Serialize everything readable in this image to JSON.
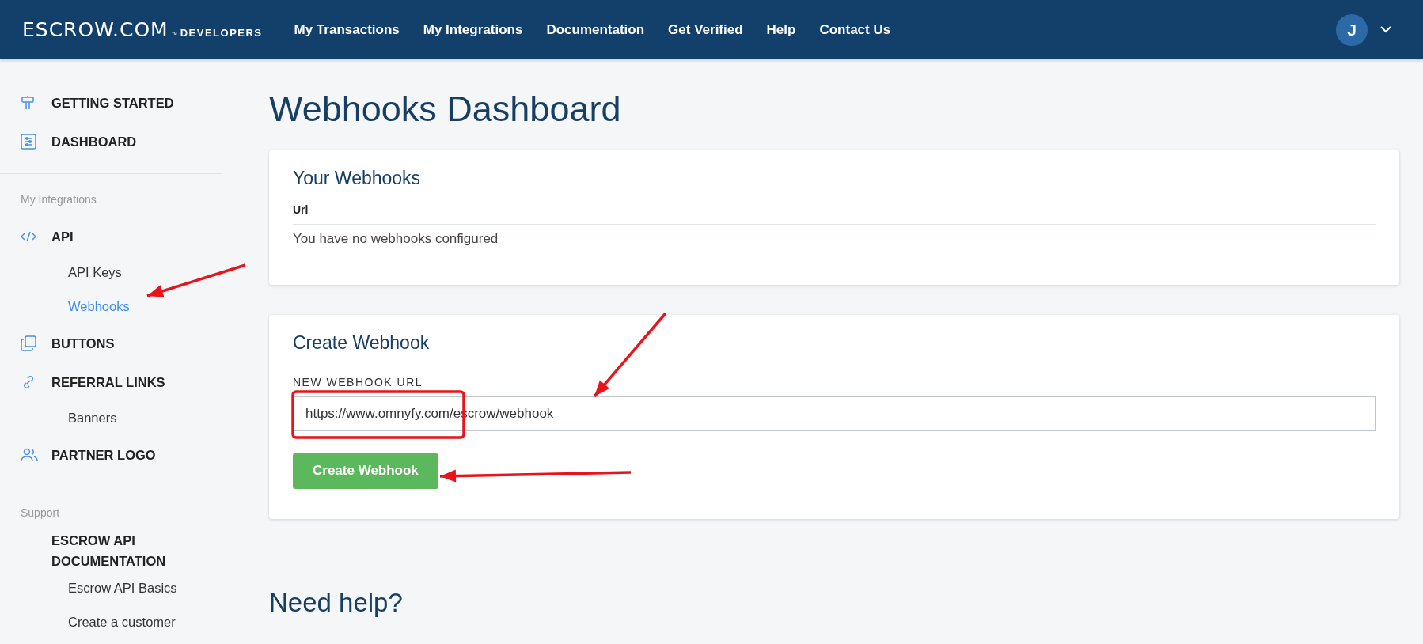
{
  "header": {
    "logo": "ESCROW.COM",
    "logo_mark": "™",
    "logo_sub": "DEVELOPERS",
    "nav": [
      "My Transactions",
      "My Integrations",
      "Documentation",
      "Get Verified",
      "Help",
      "Contact Us"
    ],
    "avatar": "J"
  },
  "sidebar": {
    "sections": [
      {
        "items": [
          {
            "label": "GETTING STARTED",
            "selected": false
          },
          {
            "label": "DASHBOARD",
            "selected": false
          }
        ]
      },
      {
        "heading": "My Integrations",
        "items": [
          {
            "label": "API",
            "selected": false,
            "children": [
              {
                "label": "API Keys",
                "selected": false
              },
              {
                "label": "Webhooks",
                "selected": true
              }
            ]
          },
          {
            "label": "BUTTONS",
            "selected": false
          },
          {
            "label": "REFERRAL LINKS",
            "selected": false,
            "children": [
              {
                "label": "Banners",
                "selected": false
              }
            ]
          },
          {
            "label": "PARTNER LOGO",
            "selected": false
          }
        ]
      },
      {
        "heading": "Support",
        "items": [
          {
            "label": "ESCROW API DOCUMENTATION",
            "selected": false,
            "children": [
              {
                "label": "Escrow API Basics",
                "selected": false
              },
              {
                "label": "Create a customer",
                "selected": false
              }
            ]
          }
        ]
      }
    ]
  },
  "page_title": "Webhooks Dashboard",
  "webhooks_card": {
    "title": "Your Webhooks",
    "column": "Url",
    "empty_message": "You have no webhooks configured"
  },
  "create_card": {
    "title": "Create Webhook",
    "field_label": "NEW WEBHOOK URL",
    "field_value": "https://www.omnyfy.com/escrow/webhook",
    "button": "Create Webhook"
  },
  "help_title": "Need help?",
  "annotations": [
    {
      "kind": "arrow"
    },
    {
      "kind": "arrow"
    },
    {
      "kind": "arrow"
    },
    {
      "kind": "box"
    }
  ]
}
